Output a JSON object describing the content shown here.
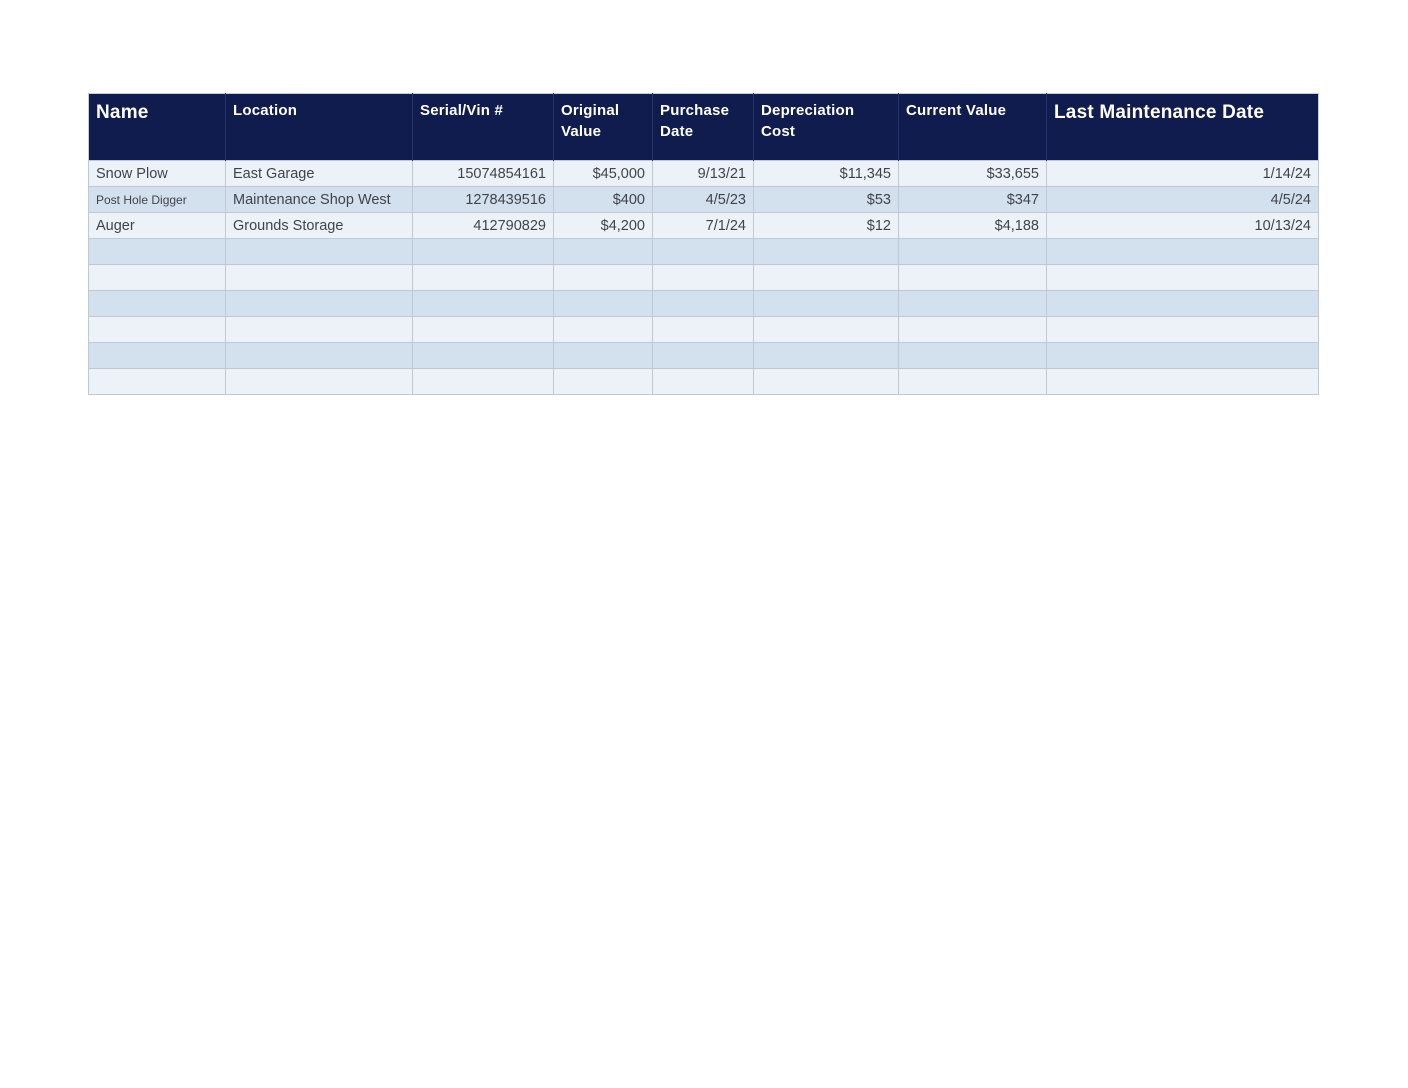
{
  "page": {
    "background": "#ffffff"
  },
  "table": {
    "columns": [
      {
        "id": "name",
        "label": "Name",
        "emphasis": "large"
      },
      {
        "id": "location",
        "label": "Location",
        "emphasis": "normal"
      },
      {
        "id": "serial-vin",
        "label": "Serial/Vin #",
        "emphasis": "normal"
      },
      {
        "id": "original-value",
        "label": "Original Value",
        "emphasis": "normal"
      },
      {
        "id": "purchase-date",
        "label": "Purchase Date",
        "emphasis": "normal"
      },
      {
        "id": "depreciation-cost",
        "label": "Depreciation Cost",
        "emphasis": "normal"
      },
      {
        "id": "current-value",
        "label": "Current Value",
        "emphasis": "normal"
      },
      {
        "id": "last-maintenance-date",
        "label": "Last Maintenance Date",
        "emphasis": "large"
      }
    ],
    "cell_align": [
      "left",
      "left",
      "right",
      "right",
      "right",
      "right",
      "right",
      "right"
    ],
    "rows": [
      [
        "Snow Plow",
        "East Garage",
        "15074854161",
        "$45,000",
        "9/13/21",
        "$11,345",
        "$33,655",
        "1/14/24"
      ],
      [
        "Post Hole Digger",
        "Maintenance Shop West",
        "1278439516",
        "$400",
        "4/5/23",
        "$53",
        "$347",
        "4/5/24"
      ],
      [
        "Auger",
        "Grounds Storage",
        "412790829",
        "$4,200",
        "7/1/24",
        "$12",
        "$4,188",
        "10/13/24"
      ]
    ],
    "small_font_cells": [
      [
        1,
        0
      ]
    ],
    "empty_rows": 6,
    "colors": {
      "page_bg": "#ffffff",
      "header_bg": "#101c4e",
      "header_text": "#ffffff",
      "header_divider": "#27336b",
      "row_light": "#edf2f8",
      "row_dark": "#d3e0ee",
      "border": "#bfc9d3",
      "cell_text": "#3f444b"
    }
  }
}
